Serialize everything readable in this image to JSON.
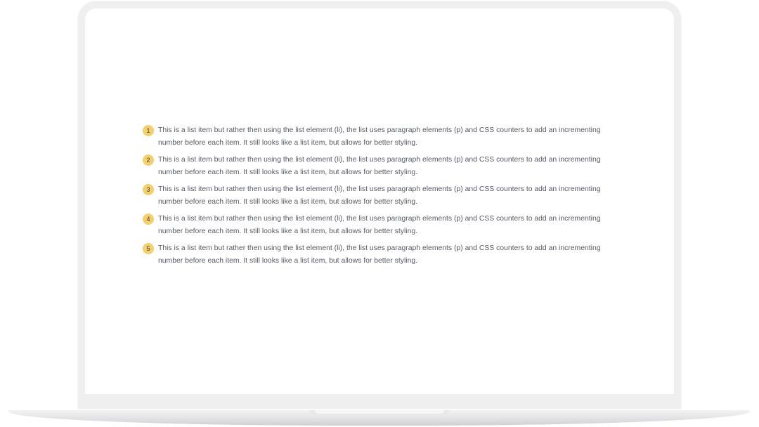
{
  "list": {
    "items": [
      {
        "number": "1",
        "text": "This is a list item but rather then using the list element (li), the list uses paragraph elements (p) and CSS counters to add an incrementing number before each item. It still looks like a list item, but allows for better styling."
      },
      {
        "number": "2",
        "text": "This is a list item but rather then using the list element (li), the list uses paragraph elements (p) and CSS counters to add an incrementing number before each item. It still looks like a list item, but allows for better styling."
      },
      {
        "number": "3",
        "text": "This is a list item but rather then using the list element (li), the list uses paragraph elements (p) and CSS counters to add an incrementing number before each item. It still looks like a list item, but allows for better styling."
      },
      {
        "number": "4",
        "text": "This is a list item but rather then using the list element (li), the list uses paragraph elements (p) and CSS counters to add an incrementing number before each item. It still looks like a list item, but allows for better styling."
      },
      {
        "number": "5",
        "text": "This is a list item but rather then using the list element (li), the list uses paragraph elements (p) and CSS counters to add an incrementing number before each item. It still looks like a list item, but allows for better styling."
      }
    ]
  },
  "colors": {
    "badge": "#f4cf6d",
    "text": "#555a60",
    "frame": "#efeff0"
  }
}
